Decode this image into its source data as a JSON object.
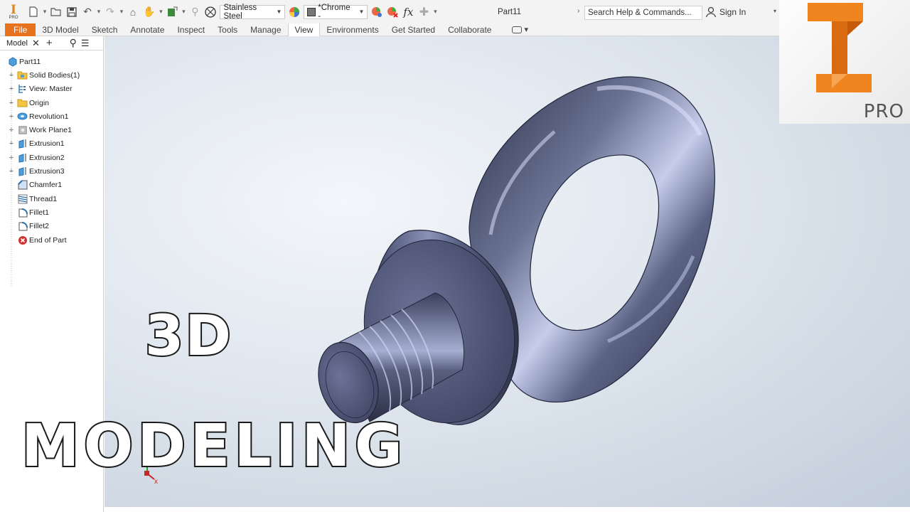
{
  "quick_access": {
    "app_logo_letters": "PRO",
    "material": "Stainless Steel",
    "appearance": "*Chrome -",
    "fx": "fx",
    "document_title": "Part11",
    "search_placeholder": "Search Help & Commands...",
    "sign_in": "Sign In"
  },
  "ribbon": {
    "tabs": [
      {
        "label": "File"
      },
      {
        "label": "3D Model"
      },
      {
        "label": "Sketch"
      },
      {
        "label": "Annotate"
      },
      {
        "label": "Inspect"
      },
      {
        "label": "Tools"
      },
      {
        "label": "Manage"
      },
      {
        "label": "View"
      },
      {
        "label": "Environments"
      },
      {
        "label": "Get Started"
      },
      {
        "label": "Collaborate"
      }
    ],
    "active_tab": "View"
  },
  "browser": {
    "title": "Model",
    "items": [
      {
        "label": "Part11",
        "icon": "part-icon"
      },
      {
        "label": "Solid Bodies(1)",
        "icon": "folder-icon"
      },
      {
        "label": "View: Master",
        "icon": "view-icon"
      },
      {
        "label": "Origin",
        "icon": "folder-icon"
      },
      {
        "label": "Revolution1",
        "icon": "revolution-icon"
      },
      {
        "label": "Work Plane1",
        "icon": "workplane-icon"
      },
      {
        "label": "Extrusion1",
        "icon": "extrusion-icon"
      },
      {
        "label": "Extrusion2",
        "icon": "extrusion-icon"
      },
      {
        "label": "Extrusion3",
        "icon": "extrusion-icon"
      },
      {
        "label": "Chamfer1",
        "icon": "chamfer-icon"
      },
      {
        "label": "Thread1",
        "icon": "thread-icon"
      },
      {
        "label": "Fillet1",
        "icon": "fillet-icon"
      },
      {
        "label": "Fillet2",
        "icon": "fillet-icon"
      },
      {
        "label": "End of Part",
        "icon": "end-of-part-icon"
      }
    ]
  },
  "overlay": {
    "title_line1": "3D",
    "title_line2": "MODELING"
  },
  "triad": {
    "x_label": "x"
  },
  "brand": {
    "badge": "PRO"
  },
  "colors": {
    "file_tab": "#e8731e",
    "logo_orange": "#f0841e",
    "model_metal": "#4f5573"
  }
}
